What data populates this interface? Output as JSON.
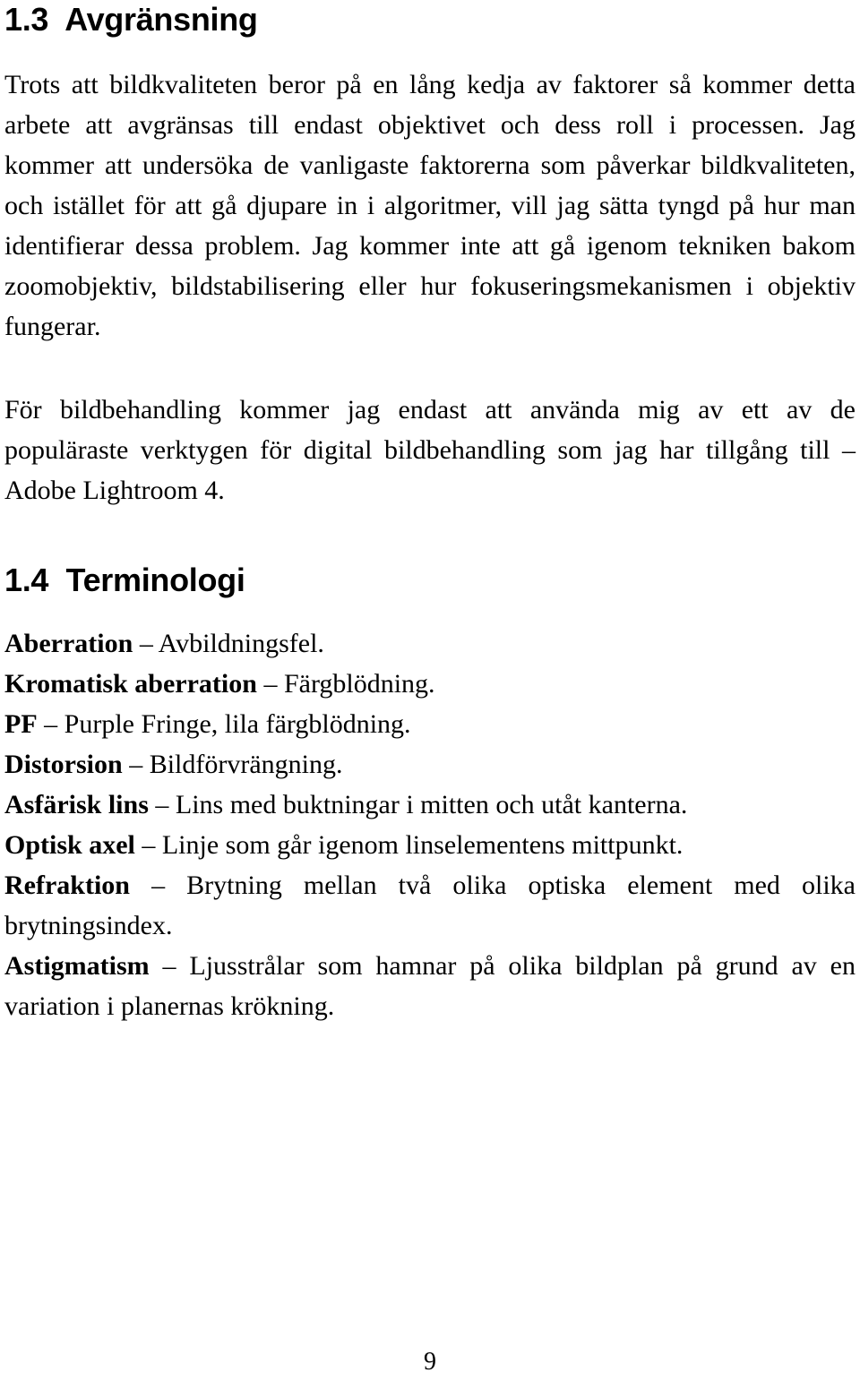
{
  "document": {
    "language": "sv",
    "page_number": "9"
  },
  "sections": [
    {
      "number": "1.3",
      "title": "Avgränsning",
      "heading_text": "1.3  Avgränsning",
      "paragraphs": [
        "Trots att bildkvaliteten beror på en lång kedja av faktorer så kommer detta arbete att avgränsas till endast objektivet och dess roll i processen. Jag kommer att undersöka de vanligaste faktorerna som påverkar bildkvaliteten, och istället för att gå djupare in i algoritmer, vill jag sätta tyngd på hur man identifierar dessa problem. Jag kommer inte att gå igenom tekniken bakom zoomobjektiv, bildstabilisering eller hur fokuseringsmekanismen i objektiv fungerar.",
        "För bildbehandling kommer jag endast att använda mig av ett av de populäraste verktygen för digital bildbehandling som jag har tillgång till – Adobe Lightroom 4."
      ]
    },
    {
      "number": "1.4",
      "title": "Terminologi",
      "heading_text": "1.4  Terminologi",
      "terms": [
        {
          "term": "Aberration",
          "dash": " – ",
          "definition": "Avbildningsfel."
        },
        {
          "term": "Kromatisk aberration",
          "dash": " – ",
          "definition": "Färgblödning."
        },
        {
          "term": "PF",
          "dash": " – ",
          "definition": "Purple Fringe, lila färgblödning."
        },
        {
          "term": "Distorsion",
          "dash": " – ",
          "definition": "Bildförvrängning."
        },
        {
          "term": "Asfärisk lins",
          "dash": " – ",
          "definition": "Lins med buktningar i mitten och utåt kanterna."
        },
        {
          "term": "Optisk axel",
          "dash": " – ",
          "definition": "Linje som går igenom linselementens mittpunkt."
        },
        {
          "term": "Refraktion",
          "dash": " – ",
          "definition": "Brytning mellan två olika optiska element med olika brytningsindex."
        },
        {
          "term": "Astigmatism",
          "dash": " – ",
          "definition": "Ljusstrålar som hamnar på olika bildplan på grund av en variation i planernas krökning."
        }
      ]
    }
  ]
}
